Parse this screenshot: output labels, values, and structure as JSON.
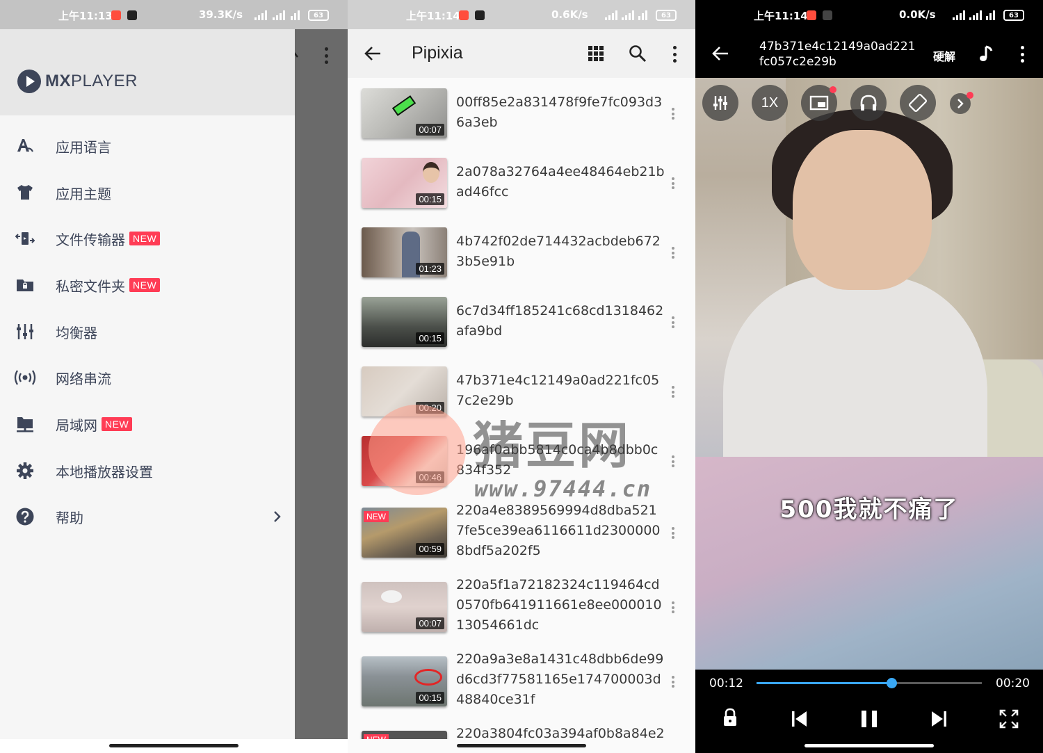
{
  "status_bars": [
    {
      "time": "上午11:13",
      "net": "39.3K/s",
      "battery": "63"
    },
    {
      "time": "上午11:14",
      "net": "0.6K/s",
      "battery": "63"
    },
    {
      "time": "上午11:14",
      "net": "0.0K/s",
      "battery": "63"
    }
  ],
  "drawer": {
    "logo_bold": "MX",
    "logo_rest": "PLAYER",
    "items": [
      {
        "label": "应用语言",
        "icon": "language-icon",
        "badge": ""
      },
      {
        "label": "应用主题",
        "icon": "tshirt-icon",
        "badge": ""
      },
      {
        "label": "文件传输器",
        "icon": "file-transfer-icon",
        "badge": "NEW"
      },
      {
        "label": "私密文件夹",
        "icon": "private-folder-icon",
        "badge": "NEW"
      },
      {
        "label": "均衡器",
        "icon": "equalizer-icon",
        "badge": ""
      },
      {
        "label": "网络串流",
        "icon": "network-stream-icon",
        "badge": ""
      },
      {
        "label": "局域网",
        "icon": "lan-icon",
        "badge": "NEW"
      },
      {
        "label": "本地播放器设置",
        "icon": "gear-icon",
        "badge": ""
      },
      {
        "label": "帮助",
        "icon": "help-icon",
        "badge": ""
      }
    ]
  },
  "folder": {
    "title": "Pipixia",
    "videos": [
      {
        "title": "00ff85e2a831478f9fe7fc093d36a3eb",
        "duration": "00:07",
        "new": false
      },
      {
        "title": "2a078a32764a4ee48464eb21bad46fcc",
        "duration": "00:15",
        "new": false
      },
      {
        "title": "4b742f02de714432acbdeb6723b5e91b",
        "duration": "01:23",
        "new": false
      },
      {
        "title": "6c7d34ff185241c68cd1318462afa9bd",
        "duration": "00:15",
        "new": false
      },
      {
        "title": "47b371e4c12149a0ad221fc057c2e29b",
        "duration": "00:20",
        "new": false
      },
      {
        "title": "196af0abb5814c0ca4b8dbb0c834f352",
        "duration": "00:46",
        "new": false
      },
      {
        "title": "220a4e8389569994d8dba5217fe5ce39ea6116611d23000008bdf5a202f5",
        "duration": "00:59",
        "new": true
      },
      {
        "title": "220a5f1a72182324c119464cd0570fb641911661e8ee00001013054661dc",
        "duration": "00:07",
        "new": false
      },
      {
        "title": "220a9a3e8a1431c48dbb6de99d6cd3f77581165e174700003d48840ce31f",
        "duration": "00:15",
        "new": false
      },
      {
        "title": "220a3804fc03a394af0b8a84e2",
        "duration": "",
        "new": true
      }
    ],
    "new_badge": "NEW"
  },
  "watermark": {
    "text": "猪豆网",
    "url": "www.97444.cn"
  },
  "player": {
    "title": "47b371e4c12149a0ad221fc057c2e29b",
    "decoder": "硬解",
    "speed": "1X",
    "subtitle": "500我就不痛了",
    "current": "00:12",
    "duration": "00:20",
    "progress_fraction": 0.6
  },
  "colors": {
    "accent": "#3aa8f5",
    "badge": "#ff3c55",
    "drawer_text": "#3d4559"
  }
}
